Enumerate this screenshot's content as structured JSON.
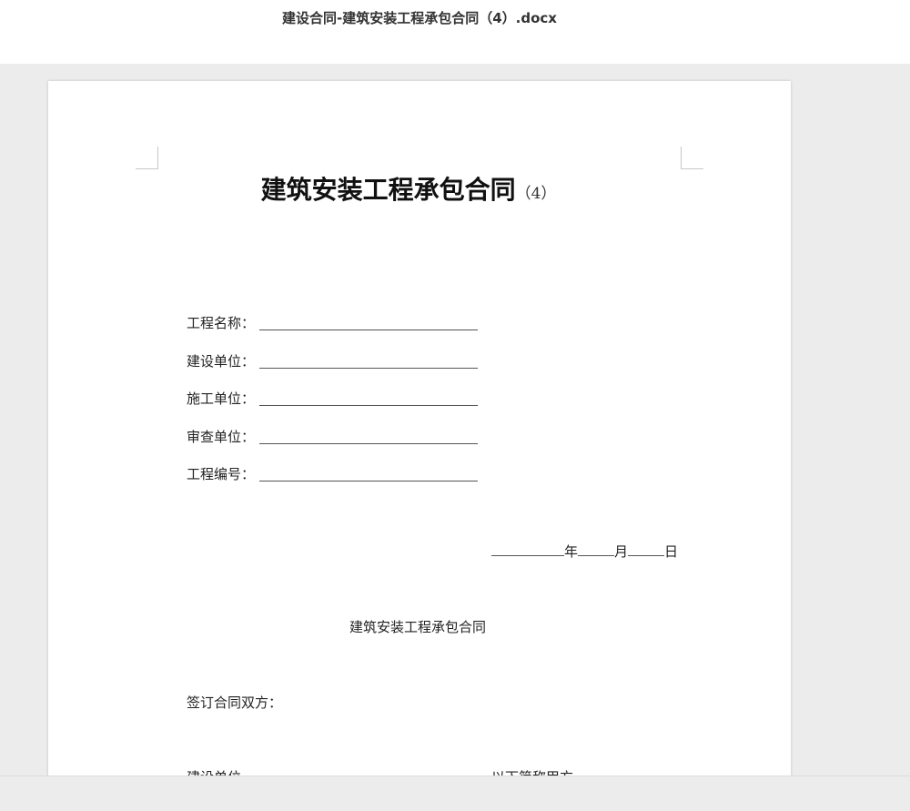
{
  "header": {
    "file_name": "建设合同-建筑安装工程承包合同（4）.docx"
  },
  "document": {
    "title_main": "建筑安装工程承包合同",
    "title_suffix": "（4）",
    "fields": [
      {
        "label": "工程名称："
      },
      {
        "label": "建设单位："
      },
      {
        "label": "施工单位："
      },
      {
        "label": "审查单位："
      },
      {
        "label": "工程编号："
      }
    ],
    "date": {
      "year": "年",
      "month": "月",
      "day": "日"
    },
    "subtitle": "建筑安装工程承包合同",
    "parties_label": "签订合同双方：",
    "cut_left": "建设单位",
    "cut_right": "以下简称甲方"
  }
}
